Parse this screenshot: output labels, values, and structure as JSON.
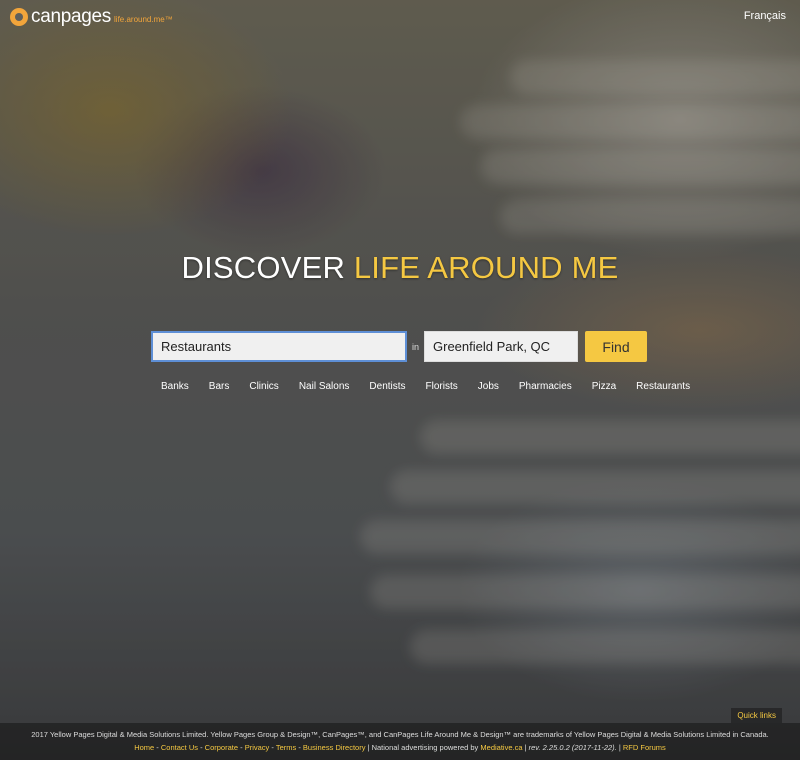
{
  "header": {
    "logo_text": "canpages",
    "logo_tagline": "life.around.me™",
    "language_link": "Français"
  },
  "hero": {
    "title_white": "DISCOVER ",
    "title_yellow": "LIFE AROUND ME"
  },
  "search": {
    "what_value": "Restaurants",
    "in_label": "in",
    "where_value": "Greenfield Park, QC",
    "find_label": "Find"
  },
  "quick_categories": [
    "Banks",
    "Bars",
    "Clinics",
    "Nail Salons",
    "Dentists",
    "Florists",
    "Jobs",
    "Pharmacies",
    "Pizza",
    "Restaurants"
  ],
  "quick_links_label": "Quick links",
  "footer": {
    "copyright": "2017 Yellow Pages Digital & Media Solutions Limited. Yellow Pages Group & Design™, CanPages™, and CanPages Life Around Me & Design™ are trademarks of Yellow Pages Digital & Media Solutions Limited in Canada.",
    "links": {
      "home": "Home",
      "contact": "Contact Us",
      "corporate": "Corporate",
      "privacy": "Privacy",
      "terms": "Terms",
      "directory": "Business Directory"
    },
    "national_text": "National advertising powered by",
    "mediative": "Mediative.ca",
    "rev": "rev. 2.25.0.2 (2017-11-22).",
    "rfd": "RFD Forums"
  },
  "colors": {
    "accent_yellow": "#f5c842",
    "logo_orange": "#f2a53b",
    "input_focus_border": "#5e8fd6"
  }
}
